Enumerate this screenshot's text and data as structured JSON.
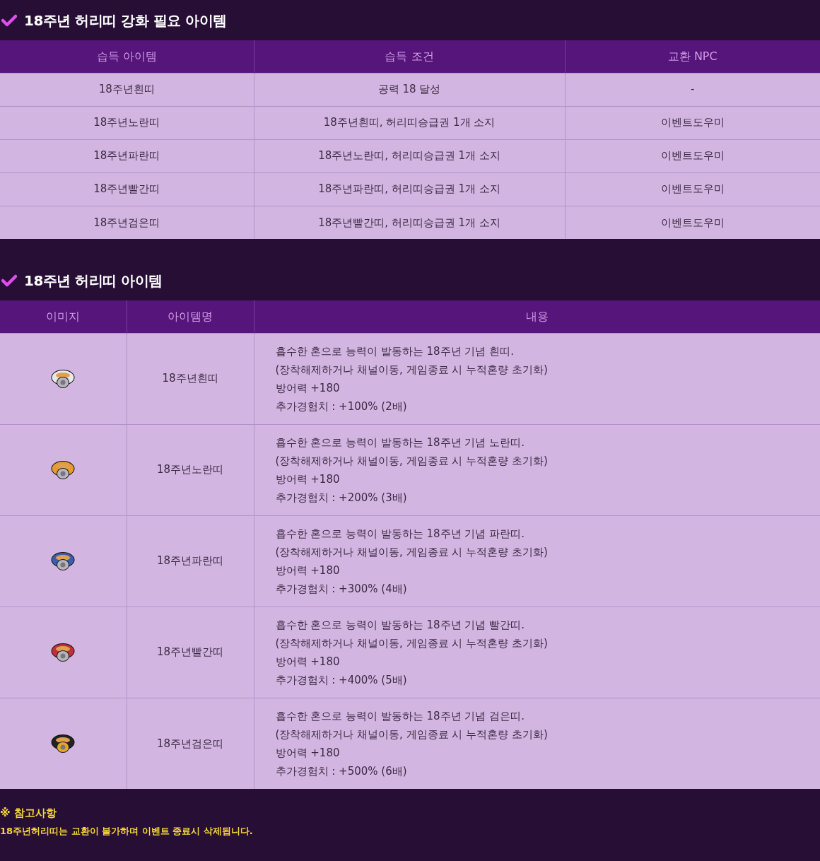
{
  "sections": [
    {
      "title": "18주년 허리띠 강화 필요 아이템",
      "table": {
        "kind": "requirements",
        "columns": [
          "습득 아이템",
          "습득 조건",
          "교환 NPC"
        ],
        "rows": [
          {
            "cells": [
              "18주년흰띠",
              "공력 18 달성",
              "-"
            ]
          },
          {
            "cells": [
              "18주년노란띠",
              "18주년흰띠, 허리띠승급권 1개 소지",
              "이벤트도우미"
            ]
          },
          {
            "cells": [
              "18주년파란띠",
              "18주년노란띠, 허리띠승급권 1개 소지",
              "이벤트도우미"
            ]
          },
          {
            "cells": [
              "18주년빨간띠",
              "18주년파란띠, 허리띠승급권 1개 소지",
              "이벤트도우미"
            ]
          },
          {
            "cells": [
              "18주년검은띠",
              "18주년빨간띠, 허리띠승급권 1개 소지",
              "이벤트도우미"
            ]
          }
        ]
      }
    },
    {
      "title": "18주년 허리띠 아이템",
      "table": {
        "kind": "items",
        "columns": [
          "이미지",
          "아이템명",
          "내용"
        ],
        "rows": [
          {
            "image": {
              "kind": "belt",
              "color": "#e8e8e8"
            },
            "name": "18주년흰띠",
            "lines": [
              "흡수한 혼으로 능력이 발동하는 18주년 기념 흰띠.",
              "(장착해제하거나 채널이동, 게임종료 시 누적혼량 초기화)",
              "방어력 +180",
              "추가경험치 : +100% (2배)"
            ]
          },
          {
            "image": {
              "kind": "belt",
              "color": "#e89a30"
            },
            "name": "18주년노란띠",
            "lines": [
              "흡수한 혼으로 능력이 발동하는 18주년 기념 노란띠.",
              "(장착해제하거나 채널이동, 게임종료 시 누적혼량 초기화)",
              "방어력 +180",
              "추가경험치 : +200% (3배)"
            ]
          },
          {
            "image": {
              "kind": "belt",
              "color": "#3a5fb0"
            },
            "name": "18주년파란띠",
            "lines": [
              "흡수한 혼으로 능력이 발동하는 18주년 기념 파란띠.",
              "(장착해제하거나 채널이동, 게임종료 시 누적혼량 초기화)",
              "방어력 +180",
              "추가경험치 : +300% (4배)"
            ]
          },
          {
            "image": {
              "kind": "belt",
              "color": "#c0303a"
            },
            "name": "18주년빨간띠",
            "lines": [
              "흡수한 혼으로 능력이 발동하는 18주년 기념 빨간띠.",
              "(장착해제하거나 채널이동, 게임종료 시 누적혼량 초기화)",
              "방어력 +180",
              "추가경험치 : +400% (5배)"
            ]
          },
          {
            "image": {
              "kind": "belt",
              "color": "#222222"
            },
            "name": "18주년검은띠",
            "lines": [
              "흡수한 혼으로 능력이 발동하는 18주년 기념 검은띠.",
              "(장착해제하거나 채널이동, 게임종료 시 누적혼량 초기화)",
              "방어력 +180",
              "추가경험치 : +500% (6배)"
            ]
          }
        ]
      }
    }
  ],
  "notes": {
    "title": "※ 참고사항",
    "text": "18주년허리띠는 교환이 불가하며 이벤트 종료시 삭제됩니다."
  }
}
